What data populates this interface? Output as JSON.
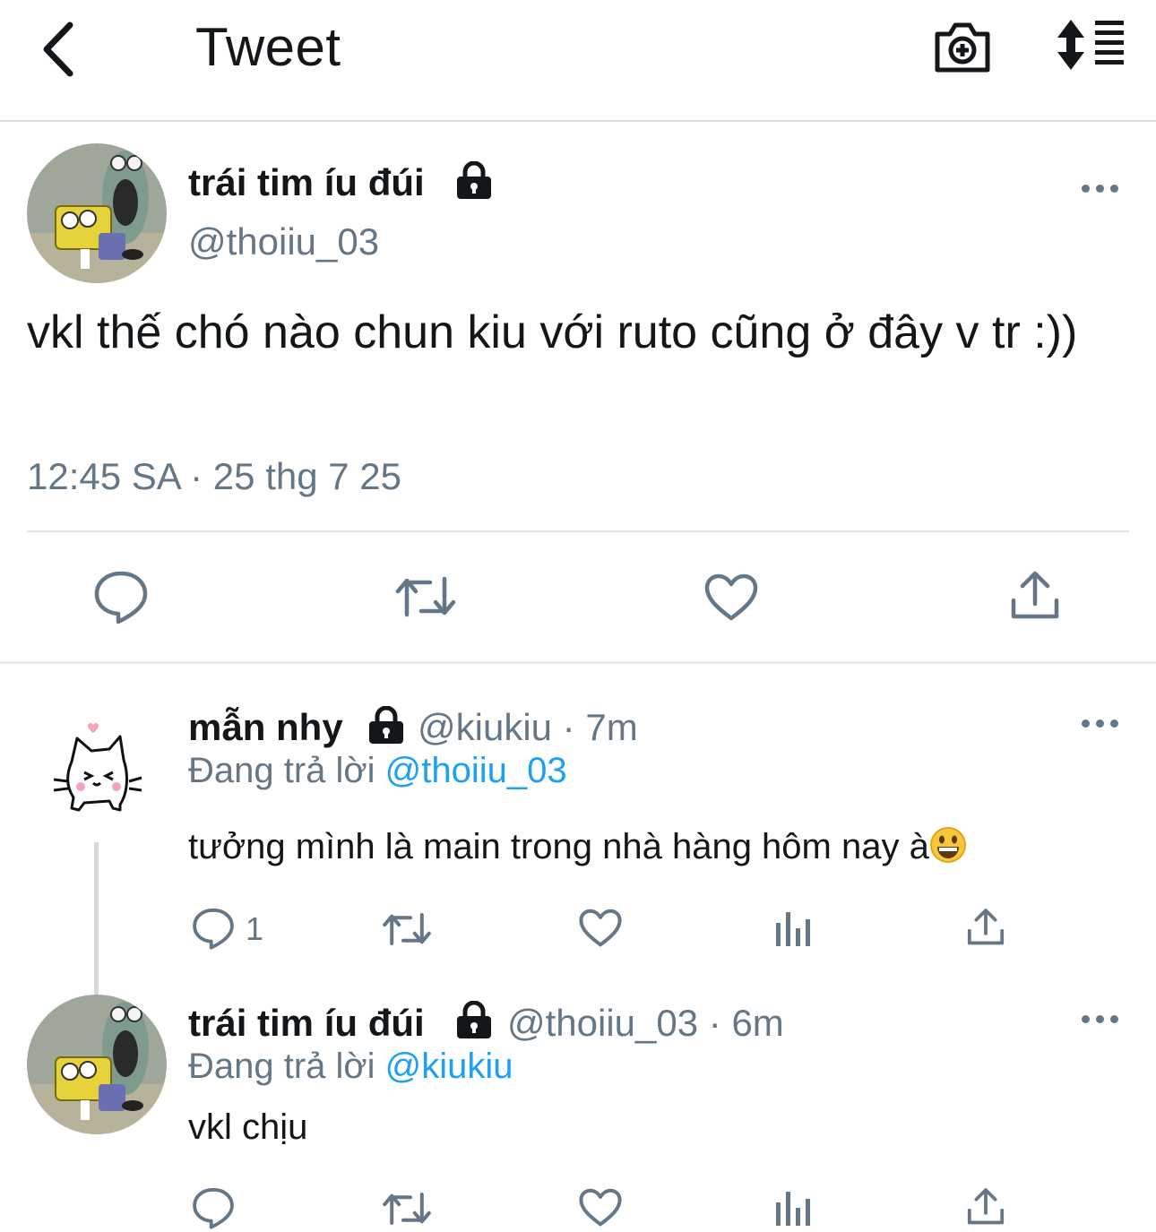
{
  "header": {
    "title": "Tweet",
    "icons": [
      "back-arrow-icon",
      "camera-plus-icon",
      "sort-icon"
    ]
  },
  "main_tweet": {
    "author_name": "trái tim íu đúi",
    "author_handle": "@thoiiu_03",
    "text": "vkl thế chó nào chun kiu với ruto cũng ở đây v tr :))",
    "timestamp": "12:45 SA · 25 thg 7 25",
    "actions": [
      "reply-icon",
      "retweet-icon",
      "like-icon",
      "share-icon"
    ]
  },
  "replies": [
    {
      "author_name": "mẫn nhy",
      "meta": "@kiukiu · 7m",
      "replying_label": "Đang trả lời",
      "replying_to": "@thoiiu_03",
      "text": "tưởng mình là main trong nhà hàng hôm nay à",
      "emoji": "grinning-face-emoji",
      "reply_count": "1"
    },
    {
      "author_name": "trái tim íu đúi",
      "meta": "@thoiiu_03 · 6m",
      "replying_label": "Đang trả lời",
      "replying_to": "@kiukiu",
      "text": "vkl chịu",
      "reply_count": ""
    }
  ],
  "colors": {
    "text": "#14171a",
    "secondary": "#657786",
    "link": "#1da1f2",
    "divider": "#e1e6ea"
  }
}
